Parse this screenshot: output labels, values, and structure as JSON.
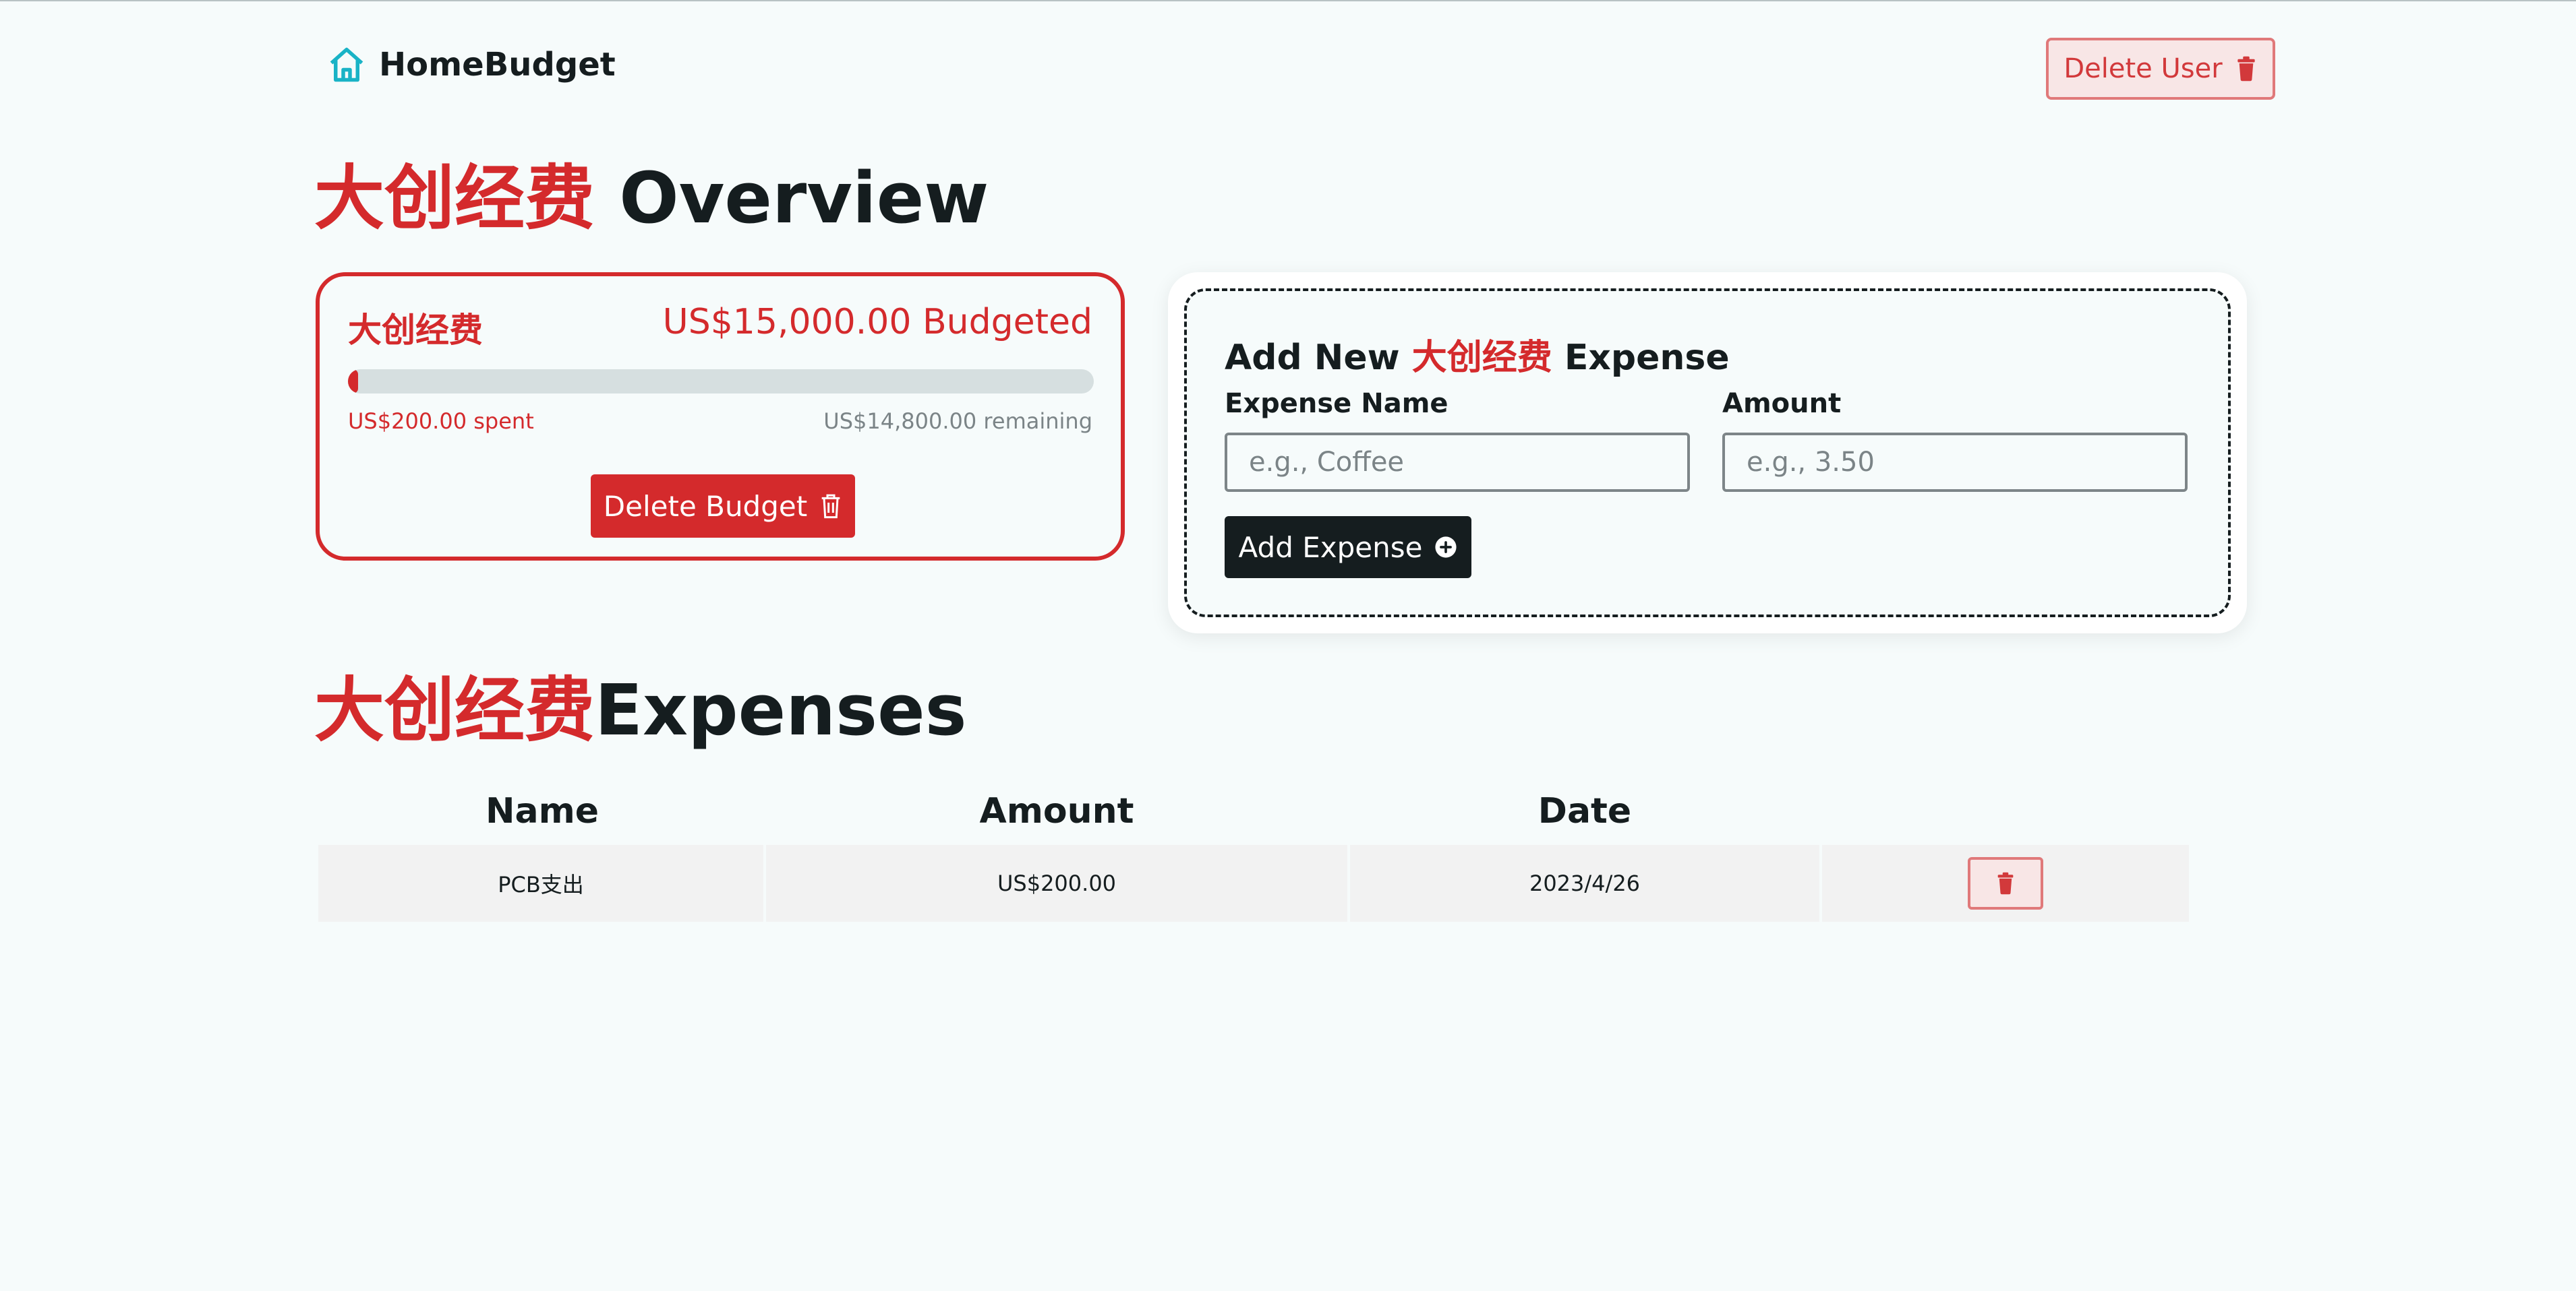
{
  "header": {
    "brand_name": "HomeBudget",
    "delete_user_label": "Delete User"
  },
  "overview": {
    "title_highlight": "大创经费",
    "title_rest": " Overview"
  },
  "budget_card": {
    "name": "大创经费",
    "budgeted": "US$15,000.00 Budgeted",
    "spent": "US$200.00 spent",
    "remaining": "US$14,800.00 remaining",
    "progress_fraction": 0.0133,
    "delete_label": "Delete Budget"
  },
  "add_expense": {
    "title_prefix": "Add New ",
    "title_highlight": "大创经费",
    "title_suffix": " Expense",
    "name_label": "Expense Name",
    "name_placeholder": "e.g., Coffee",
    "amount_label": "Amount",
    "amount_placeholder": "e.g., 3.50",
    "button_label": "Add Expense"
  },
  "expenses": {
    "title_highlight": "大创经费",
    "title_rest": "Expenses",
    "columns": [
      "Name",
      "Amount",
      "Date"
    ],
    "rows": [
      {
        "name": "PCB支出",
        "amount": "US$200.00",
        "date": "2023/4/26"
      }
    ]
  },
  "colors": {
    "accent_red": "#d42a2c",
    "brand_teal": "#19b3c6",
    "dark": "#151d1f",
    "background": "#f6fbfb"
  },
  "icons": {
    "brand": "home-icon",
    "delete": "trash-icon",
    "add": "plus-circle-icon"
  }
}
